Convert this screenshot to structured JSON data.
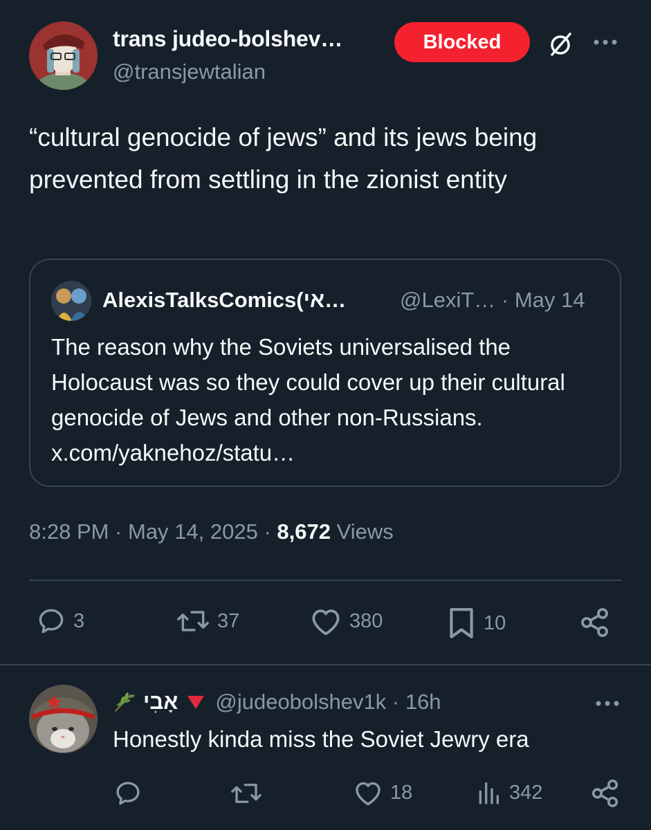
{
  "tweet": {
    "author_name": "trans judeo-bolshev…",
    "author_handle": "@transjewtalian",
    "blocked_label": "Blocked",
    "text": "“cultural genocide of jews” and its jews being prevented from settling in the zionist entity",
    "quote": {
      "name": "AlexisTalksComics(אי…",
      "handle_date": "@LexiT… · May 14",
      "text": "The reason why the Soviets universalised the Holocaust was so they could cover up their cultural genocide of Jews and other non-Russians. x.com/yaknehoz/statu…"
    },
    "time": "8:28 PM · May 14, 2025 · ",
    "views_count": "8,672",
    "views_label": " Views",
    "actions": {
      "replies": "3",
      "reposts": "37",
      "likes": "380",
      "bookmarks": "10"
    }
  },
  "reply": {
    "name": "אָבִי",
    "handle_time": "@judeobolshev1k · 16h",
    "text": "Honestly kinda miss the Soviet Jewry era",
    "actions": {
      "likes": "18",
      "views": "342"
    }
  },
  "colors": {
    "background": "#15202b",
    "text_primary": "#f7f9f9",
    "text_secondary": "#8b98a5",
    "border": "#38444d",
    "blocked_red": "#f4212e"
  },
  "icons": [
    "grok-icon",
    "more-icon",
    "reply-icon",
    "repost-icon",
    "like-icon",
    "bookmark-icon",
    "share-icon",
    "views-icon",
    "olive-branch-icon",
    "red-triangle-icon"
  ]
}
